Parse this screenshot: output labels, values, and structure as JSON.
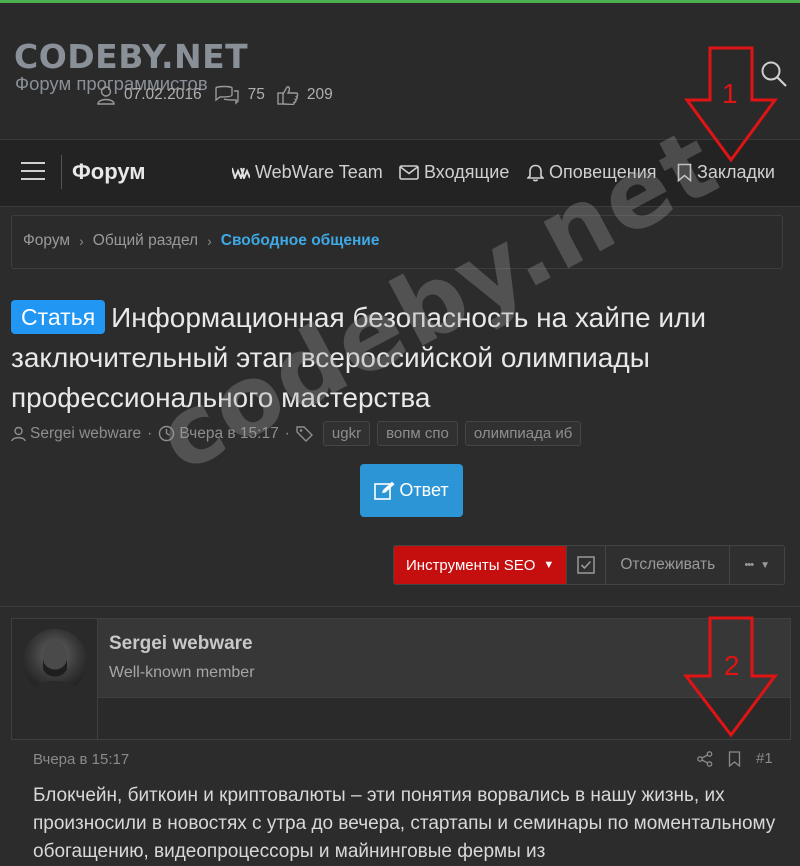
{
  "header": {
    "logo_title": "CODEBY.NET",
    "logo_subtitle": "Форум программистов"
  },
  "navbar": {
    "title": "Форум",
    "items": [
      {
        "label": "WebWare Team",
        "icon": "webware-logo-icon"
      },
      {
        "label": "Входящие",
        "icon": "envelope-icon"
      },
      {
        "label": "Оповещения",
        "icon": "bell-icon"
      },
      {
        "label": "Закладки",
        "icon": "bookmark-icon"
      }
    ]
  },
  "breadcrumb": {
    "items": [
      "Форум",
      "Общий раздел"
    ],
    "active": "Свободное общение"
  },
  "thread": {
    "prefix": "Статья",
    "title": "Информационная безопасность на хайпе или заключительный этап всероссийской олимпиады профессионального мастерства",
    "author": "Sergei webware",
    "date": "Вчера в 15:17",
    "tags": [
      "ugkr",
      "вопм спо",
      "олимпиада иб"
    ]
  },
  "reply_button": "Ответ",
  "toolbar": {
    "seo_tools": "Инструменты SEO",
    "watch": "Отслеживать",
    "more": "•••"
  },
  "post": {
    "username": "Sergei webware",
    "user_title": "Well-known member",
    "joined": "07.02.2016",
    "messages": "75",
    "reactions": "209",
    "date": "Вчера в 15:17",
    "number": "#1",
    "body": "Блокчейн, биткоин и криптовалюты – эти понятия ворвались в нашу жизнь, их произносили в новостях с утра до вечера, стартапы и семинары по моментальному обогащению, видеопроцессоры и майнинговые фермы из"
  },
  "watermark": "codeby.net",
  "annotations": [
    "1",
    "2"
  ],
  "colors": {
    "accent_blue": "#2b95d6",
    "seo_red": "#c50f0f",
    "top_line": "#4caf50",
    "arrow_red": "#e01414"
  }
}
